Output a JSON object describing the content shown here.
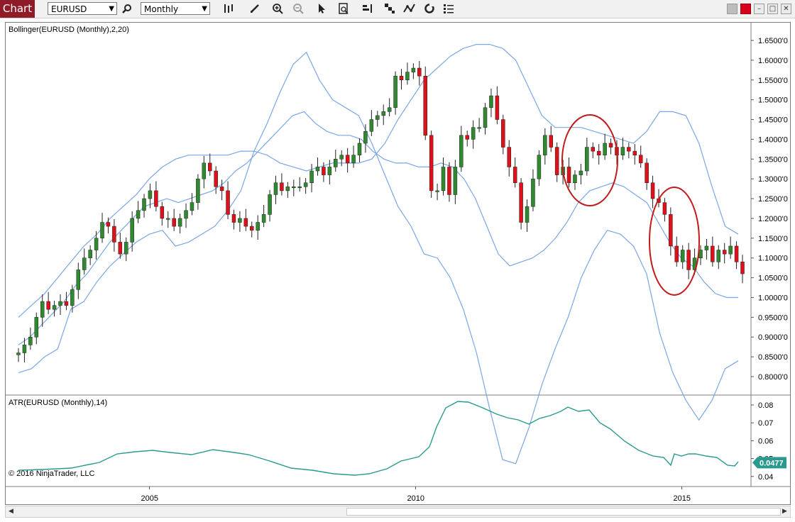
{
  "toolbar": {
    "tab_label": "Chart",
    "instrument": "EURUSD",
    "period": "Monthly",
    "icons": [
      "search-icon",
      "bar-type-icon",
      "draw-pencil-icon",
      "zoom-in-icon",
      "zoom-out-icon",
      "pointer-icon",
      "data-box-icon",
      "chart-trader-icon",
      "strategy-icon",
      "indicators-icon",
      "reload-icon",
      "properties-icon"
    ]
  },
  "window": {
    "colors": {
      "accent": "#8e1b27",
      "close": "#d8001a"
    }
  },
  "panels": {
    "price_label": "Bollinger(EURUSD (Monthly),2,20)",
    "atr_label": "ATR(EURUSD (Monthly),14)",
    "copyright": "© 2016 NinjaTrader, LLC",
    "atr_last_value": "0.0477"
  },
  "chart_data": [
    {
      "type": "candlestick",
      "title": "Bollinger(EURUSD (Monthly),2,20)",
      "ylim": [
        0.78,
        1.67
      ],
      "y_ticks": [
        "1.6500'0",
        "1.6000'0",
        "1.5500'0",
        "1.5000'0",
        "1.4500'0",
        "1.4000'0",
        "1.3500'0",
        "1.3000'0",
        "1.2500'0",
        "1.2000'0",
        "1.1500'0",
        "1.1000'0",
        "1.0500'0",
        "1.0000'0",
        "0.9500'0",
        "0.9000'0",
        "0.8500'0",
        "0.8000'0"
      ],
      "x_ticks": [
        "2005",
        "2010",
        "2015"
      ],
      "x_range": [
        2002.3,
        2016.3
      ],
      "colors": {
        "up": "#2f8a2f",
        "down": "#e0101a",
        "band": "#7aa6e6"
      },
      "close": [
        0.86,
        0.88,
        0.9,
        0.95,
        0.99,
        0.97,
        0.98,
        0.99,
        0.98,
        1.02,
        1.07,
        1.1,
        1.12,
        1.15,
        1.19,
        1.18,
        1.14,
        1.11,
        1.14,
        1.2,
        1.22,
        1.25,
        1.27,
        1.23,
        1.2,
        1.2,
        1.18,
        1.2,
        1.22,
        1.24,
        1.3,
        1.34,
        1.32,
        1.28,
        1.27,
        1.21,
        1.19,
        1.2,
        1.18,
        1.17,
        1.19,
        1.21,
        1.26,
        1.29,
        1.27,
        1.28,
        1.28,
        1.28,
        1.29,
        1.32,
        1.33,
        1.31,
        1.33,
        1.35,
        1.36,
        1.34,
        1.36,
        1.39,
        1.42,
        1.45,
        1.46,
        1.47,
        1.48,
        1.56,
        1.55,
        1.57,
        1.58,
        1.56,
        1.41,
        1.27,
        1.27,
        1.33,
        1.26,
        1.33,
        1.41,
        1.4,
        1.43,
        1.43,
        1.48,
        1.51,
        1.45,
        1.38,
        1.33,
        1.29,
        1.19,
        1.23,
        1.3,
        1.36,
        1.41,
        1.38,
        1.31,
        1.33,
        1.29,
        1.31,
        1.32,
        1.38,
        1.37,
        1.36,
        1.39,
        1.38,
        1.36,
        1.38,
        1.37,
        1.36,
        1.34,
        1.29,
        1.25,
        1.24,
        1.21,
        1.13,
        1.09,
        1.12,
        1.07,
        1.1,
        1.12,
        1.13,
        1.09,
        1.12,
        1.11,
        1.13,
        1.09,
        1.06
      ],
      "bollinger": {
        "upper": [
          0.95,
          0.98,
          1.01,
          1.05,
          1.09,
          1.13,
          1.16,
          1.2,
          1.23,
          1.26,
          1.3,
          1.33,
          1.35,
          1.36,
          1.36,
          1.36,
          1.36,
          1.37,
          1.37,
          1.36,
          1.34,
          1.33,
          1.32,
          1.33,
          1.34,
          1.34,
          1.34,
          1.35,
          1.39,
          1.45,
          1.5,
          1.55,
          1.58,
          1.61,
          1.63,
          1.64,
          1.64,
          1.63,
          1.6,
          1.53,
          1.46,
          1.43,
          1.43,
          1.43,
          1.42,
          1.41,
          1.4,
          1.39,
          1.42,
          1.47,
          1.47,
          1.46,
          1.39,
          1.28,
          1.18,
          1.16
        ],
        "middle": [
          0.88,
          0.9,
          0.93,
          0.96,
          0.99,
          1.03,
          1.06,
          1.1,
          1.14,
          1.17,
          1.2,
          1.23,
          1.24,
          1.25,
          1.24,
          1.25,
          1.26,
          1.27,
          1.29,
          1.32,
          1.34,
          1.37,
          1.4,
          1.43,
          1.46,
          1.47,
          1.44,
          1.42,
          1.41,
          1.41,
          1.4,
          1.37,
          1.35,
          1.34,
          1.34,
          1.33,
          1.33,
          1.34,
          1.33,
          1.3,
          1.25,
          1.18,
          1.11,
          1.08,
          1.09,
          1.1,
          1.12,
          1.15,
          1.19,
          1.24,
          1.27,
          1.28,
          1.29,
          1.28,
          1.26,
          1.24,
          1.19,
          1.14,
          1.1,
          1.08,
          1.04,
          1.01,
          1.0,
          1.0
        ]
      }
    },
    {
      "type": "line",
      "title": "ATR(EURUSD (Monthly),14)",
      "y_ticks": [
        "0.08",
        "0.07",
        "0.06",
        "0.05",
        "0.04"
      ],
      "ylim": [
        0.0365,
        0.0835
      ],
      "last_value": 0.0477
    }
  ]
}
